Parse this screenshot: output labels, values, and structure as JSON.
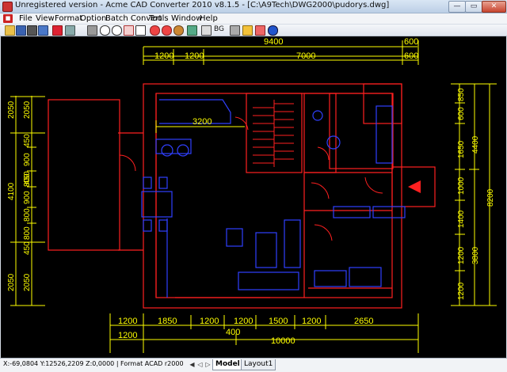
{
  "window": {
    "title": "Unregistered version - Acme CAD Converter 2010 v8.1.5 - [C:\\A9Tech\\DWG2000\\pudorys.dwg]",
    "buttons": {
      "minimize": "—",
      "maximize": "▭",
      "close": "✕"
    }
  },
  "menu": {
    "items": [
      "File",
      "View",
      "Format",
      "Option",
      "Batch Convert",
      "Tools",
      "Window",
      "Help"
    ]
  },
  "toolbar": {
    "bg_label": "BG",
    "icons": [
      "open-icon",
      "save-icon",
      "print-setup-icon",
      "save-as-icon",
      "cut-icon",
      "edit-icon",
      "print-icon",
      "zoom-in-icon",
      "zoom-out-icon",
      "zoom-window-icon",
      "zoom-extents-icon",
      "zoom-realtime-icon",
      "zoom-previous-icon",
      "pan-icon",
      "preview-icon",
      "layers-icon",
      "bg-icon",
      "warning-icon",
      "settings-icon",
      "info-icon"
    ]
  },
  "drawing": {
    "top_dims": {
      "total": "9400",
      "right": "600",
      "parts": [
        "1200",
        "1200",
        "7000"
      ],
      "right2": "600"
    },
    "left_dims": [
      "2050",
      "2050",
      "450",
      "900",
      "450",
      "4100",
      "800",
      "900",
      "800",
      "800",
      "450",
      "2050",
      "2050"
    ],
    "right_dims": [
      "850",
      "600",
      "1650",
      "4400",
      "1000",
      "8200",
      "1400",
      "1200",
      "3800",
      "1200"
    ],
    "bottom_dims": {
      "parts": [
        "1200",
        "1850",
        "1200",
        "1200",
        "1500",
        "1200",
        "2650"
      ],
      "row2": [
        "1200",
        "400",
        "10000"
      ]
    },
    "room_label": "3200"
  },
  "status": {
    "coords": "X:-69,0804 Y:12526,2209 Z:0,0000 | Format ACAD r2000",
    "tabs": [
      "Model",
      "Layout1"
    ]
  },
  "colors": {
    "wall": "#ff2020",
    "furniture": "#3040ff",
    "dimension": "#ffff00",
    "background": "#000000"
  }
}
